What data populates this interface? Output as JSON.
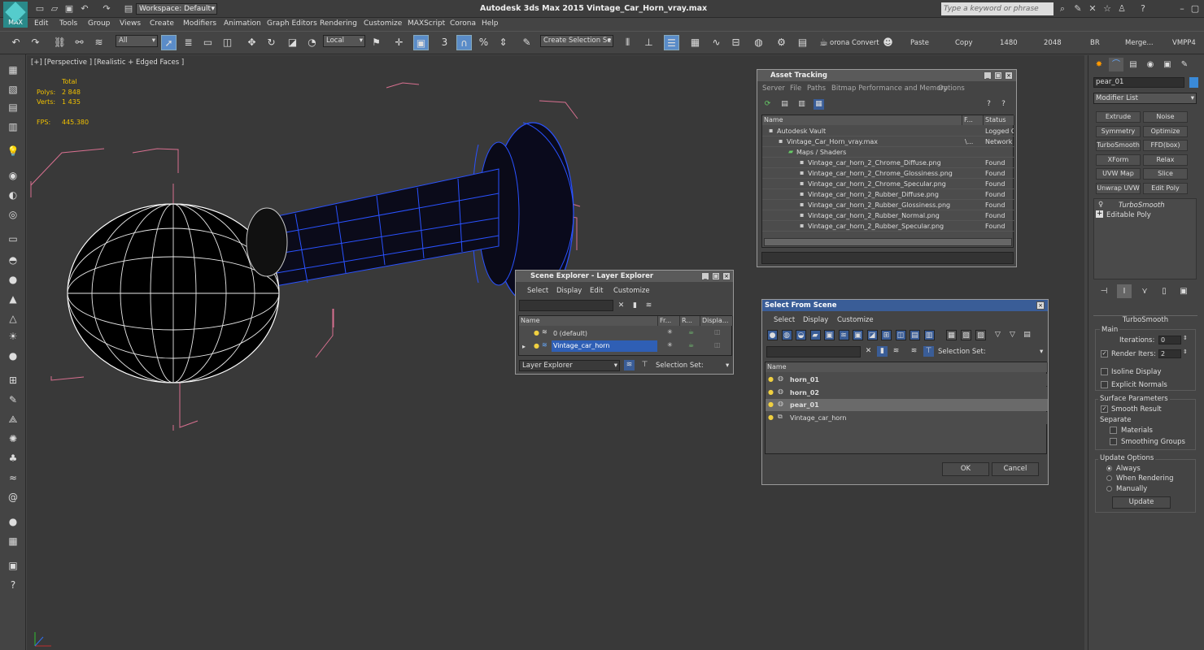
{
  "app": {
    "title": "Autodesk 3ds Max  2015      Vintage_Car_Horn_vray.max",
    "logo": "MAX",
    "workspace": "Workspace: Default",
    "search_placeholder": "Type a keyword or phrase"
  },
  "menu": [
    "Edit",
    "Tools",
    "Group",
    "Views",
    "Create",
    "Modifiers",
    "Animation",
    "Graph Editors",
    "Rendering",
    "Customize",
    "MAXScript",
    "Corona",
    "Help"
  ],
  "toolbar": {
    "filter_value": "All",
    "coord_value": "Local",
    "selection_set_placeholder": "Create Selection Se",
    "corona_convert": "orona Convert",
    "paste": "Paste",
    "copy": "Copy",
    "res_w": "1480",
    "res_h": "2048",
    "br": "BR",
    "merge": "Merge...",
    "vmpp": "VMPP4",
    "snap_num": "3"
  },
  "viewport": {
    "label": "[+] [Perspective ] [Realistic + Edged Faces ]",
    "stats_header": "Total",
    "polys_label": "Polys:",
    "polys_value": "2 848",
    "verts_label": "Verts:",
    "verts_value": "1 435",
    "fps_label": "FPS:",
    "fps_value": "445.380"
  },
  "asset_tracking": {
    "title": "Asset Tracking",
    "menu": [
      "Server",
      "File",
      "Paths",
      "Bitmap Performance and Memory",
      "Options"
    ],
    "columns": [
      "Name",
      "F...",
      "Status"
    ],
    "rows": [
      {
        "name": "Autodesk Vault",
        "f": "",
        "status": "Logged O"
      },
      {
        "name": "Vintage_Car_Horn_vray.max",
        "f": "\\...",
        "status": "Network P"
      },
      {
        "name": "Maps / Shaders",
        "f": "",
        "status": ""
      },
      {
        "name": "Vintage_car_horn_2_Chrome_Diffuse.png",
        "f": "",
        "status": "Found"
      },
      {
        "name": "Vintage_car_horn_2_Chrome_Glossiness.png",
        "f": "",
        "status": "Found"
      },
      {
        "name": "Vintage_car_horn_2_Chrome_Specular.png",
        "f": "",
        "status": "Found"
      },
      {
        "name": "Vintage_car_horn_2_Rubber_Diffuse.png",
        "f": "",
        "status": "Found"
      },
      {
        "name": "Vintage_car_horn_2_Rubber_Glossiness.png",
        "f": "",
        "status": "Found"
      },
      {
        "name": "Vintage_car_horn_2_Rubber_Normal.png",
        "f": "",
        "status": "Found"
      },
      {
        "name": "Vintage_car_horn_2_Rubber_Specular.png",
        "f": "",
        "status": "Found"
      }
    ]
  },
  "scene_explorer": {
    "title": "Scene Explorer - Layer Explorer",
    "menu": [
      "Select",
      "Display",
      "Edit",
      "Customize"
    ],
    "columns": [
      "Name",
      "Fr...",
      "R...",
      "Displa..."
    ],
    "layers": [
      {
        "name": "0 (default)"
      },
      {
        "name": "Vintage_car_horn"
      }
    ],
    "explorer_type": "Layer Explorer",
    "selection_set_label": "Selection Set:"
  },
  "select_from_scene": {
    "title": "Select From Scene",
    "menu": [
      "Select",
      "Display",
      "Customize"
    ],
    "selection_set_label": "Selection Set:",
    "column": "Name",
    "items": [
      {
        "name": "horn_01",
        "bold": true
      },
      {
        "name": "horn_02",
        "bold": true
      },
      {
        "name": "pear_01",
        "bold": true
      },
      {
        "name": "Vintage_car_horn",
        "bold": false
      }
    ],
    "ok": "OK",
    "cancel": "Cancel"
  },
  "command_panel": {
    "object_name": "pear_01",
    "object_color": "#3a8ad8",
    "modifier_list": "Modifier List",
    "modifier_buttons": [
      "Extrude",
      "Noise",
      "Symmetry",
      "Optimize",
      "TurboSmooth",
      "FFD(box)",
      "XForm",
      "Relax",
      "UVW Map",
      "Slice",
      "Unwrap UVW",
      "Edit Poly"
    ],
    "stack": [
      "TurboSmooth",
      "Editable Poly"
    ],
    "rollout_title": "TurboSmooth",
    "main_label": "Main",
    "iterations_label": "Iterations:",
    "iterations_value": "0",
    "render_iters_label": "Render Iters:",
    "render_iters_value": "2",
    "isoline": "Isoline Display",
    "explicit_normals": "Explicit Normals",
    "surface_params": "Surface Parameters",
    "smooth_result": "Smooth Result",
    "separate": "Separate",
    "materials": "Materials",
    "smoothing_groups": "Smoothing Groups",
    "update_options": "Update Options",
    "always": "Always",
    "when_rendering": "When Rendering",
    "manually": "Manually",
    "update_btn": "Update"
  },
  "colors": {
    "accent": "#3a5d97",
    "selection": "#2f5fb5",
    "stats": "#f0c000",
    "wire_blue": "#1e4fff"
  }
}
